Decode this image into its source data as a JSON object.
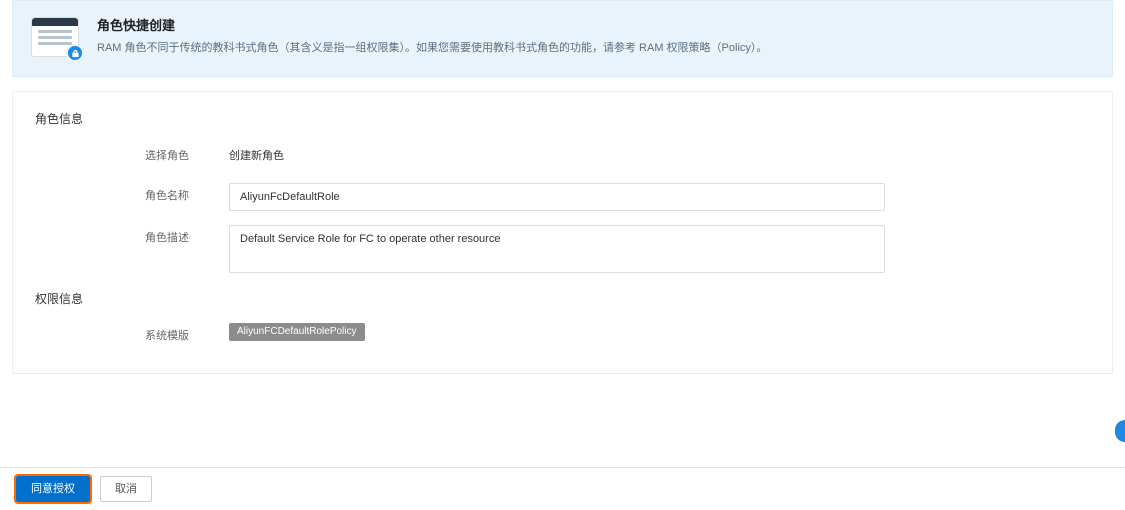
{
  "banner": {
    "title": "角色快捷创建",
    "description": "RAM 角色不同于传统的教科书式角色（其含义是指一组权限集）。如果您需要使用教科书式角色的功能，请参考 RAM 权限策略（Policy）。"
  },
  "section_role": {
    "title": "角色信息",
    "fields": {
      "select_role": {
        "label": "选择角色",
        "value": "创建新角色"
      },
      "role_name": {
        "label": "角色名称",
        "value": "AliyunFcDefaultRole"
      },
      "role_desc": {
        "label": "角色描述",
        "value": "Default Service Role for FC to operate other resource"
      }
    }
  },
  "section_perm": {
    "title": "权限信息",
    "fields": {
      "system_template": {
        "label": "系统模版",
        "tag": "AliyunFCDefaultRolePolicy"
      }
    }
  },
  "footer": {
    "confirm": "同意授权",
    "cancel": "取消"
  }
}
